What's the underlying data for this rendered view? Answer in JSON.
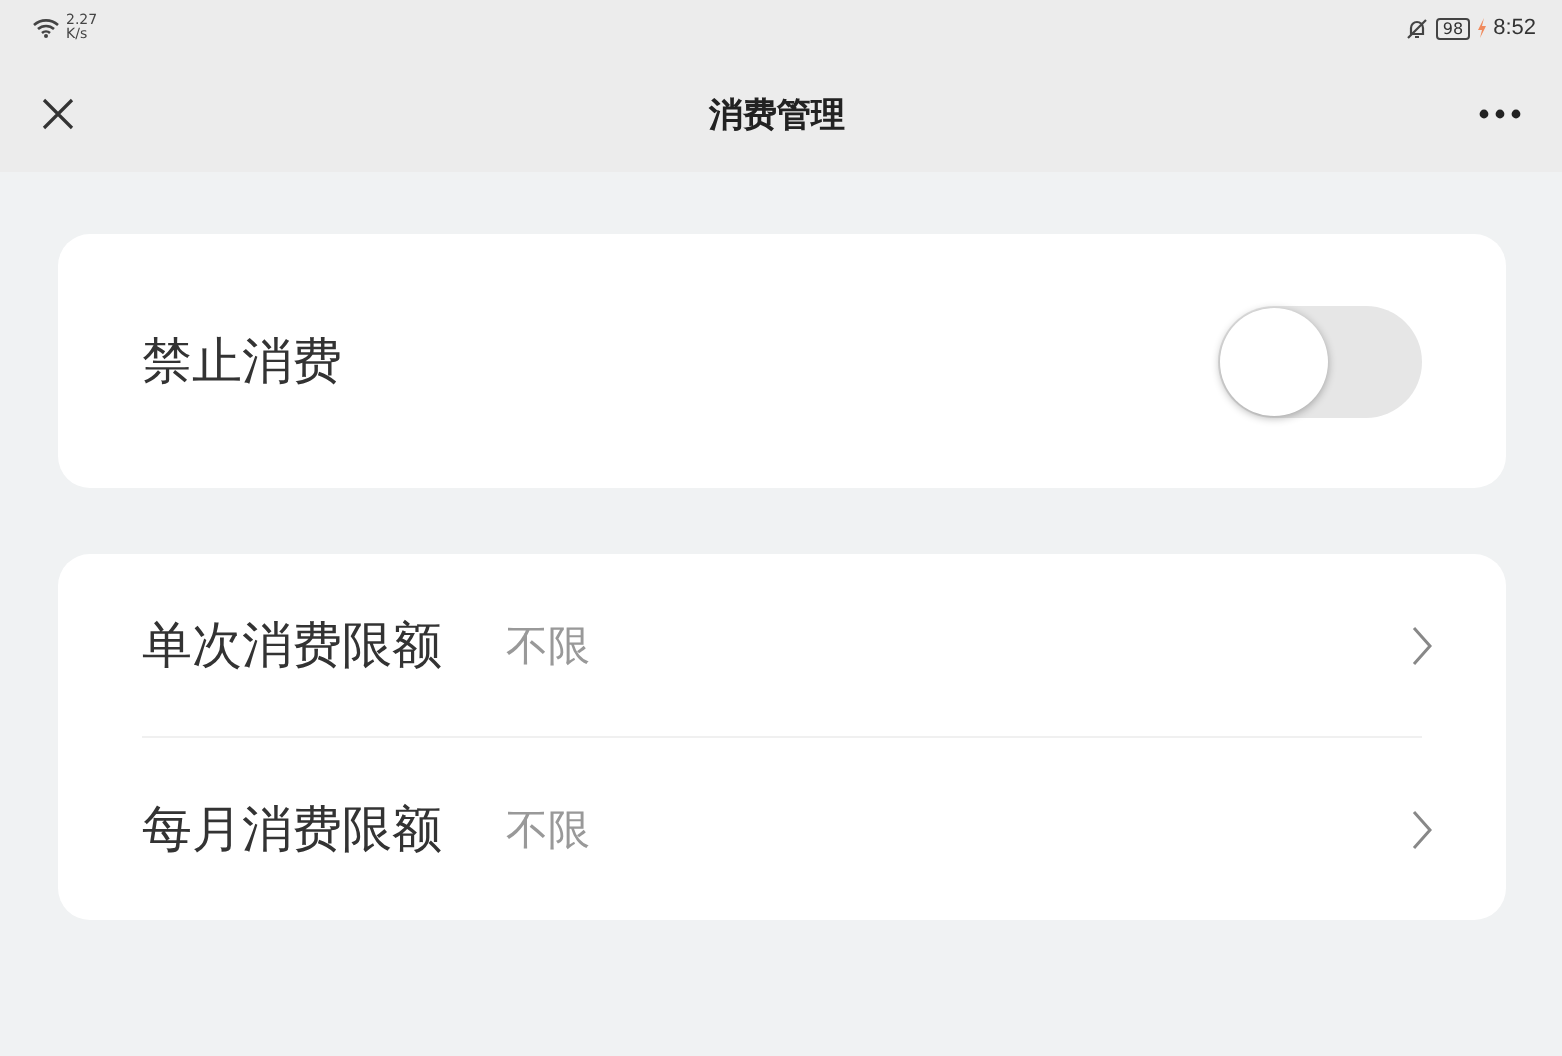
{
  "status_bar": {
    "speed_value": "2.27",
    "speed_unit": "K/s",
    "battery": "98",
    "time": "8:52"
  },
  "nav": {
    "title": "消费管理"
  },
  "switch_card": {
    "label": "禁止消费",
    "on": false
  },
  "limits": [
    {
      "label": "单次消费限额",
      "value": "不限"
    },
    {
      "label": "每月消费限额",
      "value": "不限"
    }
  ]
}
